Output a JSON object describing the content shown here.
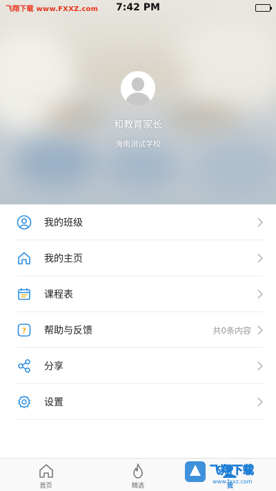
{
  "status_bar": {
    "left_text": "飞翔下载 www.FXXZ.com",
    "time": "7:42 PM"
  },
  "profile": {
    "name": "和教育家长",
    "school": "海南测试学校"
  },
  "menu": {
    "items": [
      {
        "label": "我的班级",
        "icon": "user-circle-icon",
        "extra": ""
      },
      {
        "label": "我的主页",
        "icon": "home-icon",
        "extra": ""
      },
      {
        "label": "课程表",
        "icon": "calendar-icon",
        "extra": ""
      },
      {
        "label": "帮助与反馈",
        "icon": "help-icon",
        "extra": "共0条内容"
      },
      {
        "label": "分享",
        "icon": "share-icon",
        "extra": ""
      },
      {
        "label": "设置",
        "icon": "gear-icon",
        "extra": ""
      }
    ]
  },
  "tabs": [
    {
      "label": "首页",
      "icon": "home-icon",
      "active": false
    },
    {
      "label": "精选",
      "icon": "flame-icon",
      "active": false
    },
    {
      "label": "我",
      "icon": "user-icon",
      "active": true
    }
  ],
  "watermark": {
    "text": "飞翔下载",
    "url": "www.fxxz.com"
  },
  "colors": {
    "accent": "#1e7fd6",
    "icon_blue": "#2a8de0",
    "help_yellow": "#f5b21b"
  }
}
